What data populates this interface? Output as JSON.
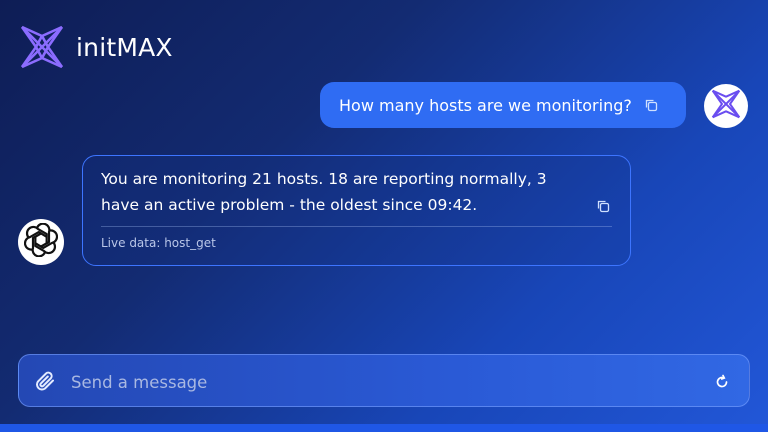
{
  "header": {
    "brand": "initMAX"
  },
  "conversation": {
    "user_message": "How many hosts are we monitoring?",
    "assistant_message": "You are monitoring 21 hosts. 18 are reporting normally, 3 have an active problem - the oldest since 09:42.",
    "assistant_source": "Live data: host_get"
  },
  "composer": {
    "placeholder": "Send a message"
  },
  "icons": {
    "logo": "initmax-logo-icon",
    "copy": "copy-icon",
    "user_avatar": "initmax-avatar-icon",
    "assistant_avatar": "openai-icon",
    "attach": "paperclip-icon",
    "refresh": "refresh-icon"
  },
  "colors": {
    "user_bubble": "#2f6cf3",
    "assistant_border": "#3d75ff",
    "logo_accent": "#8b6cff"
  }
}
